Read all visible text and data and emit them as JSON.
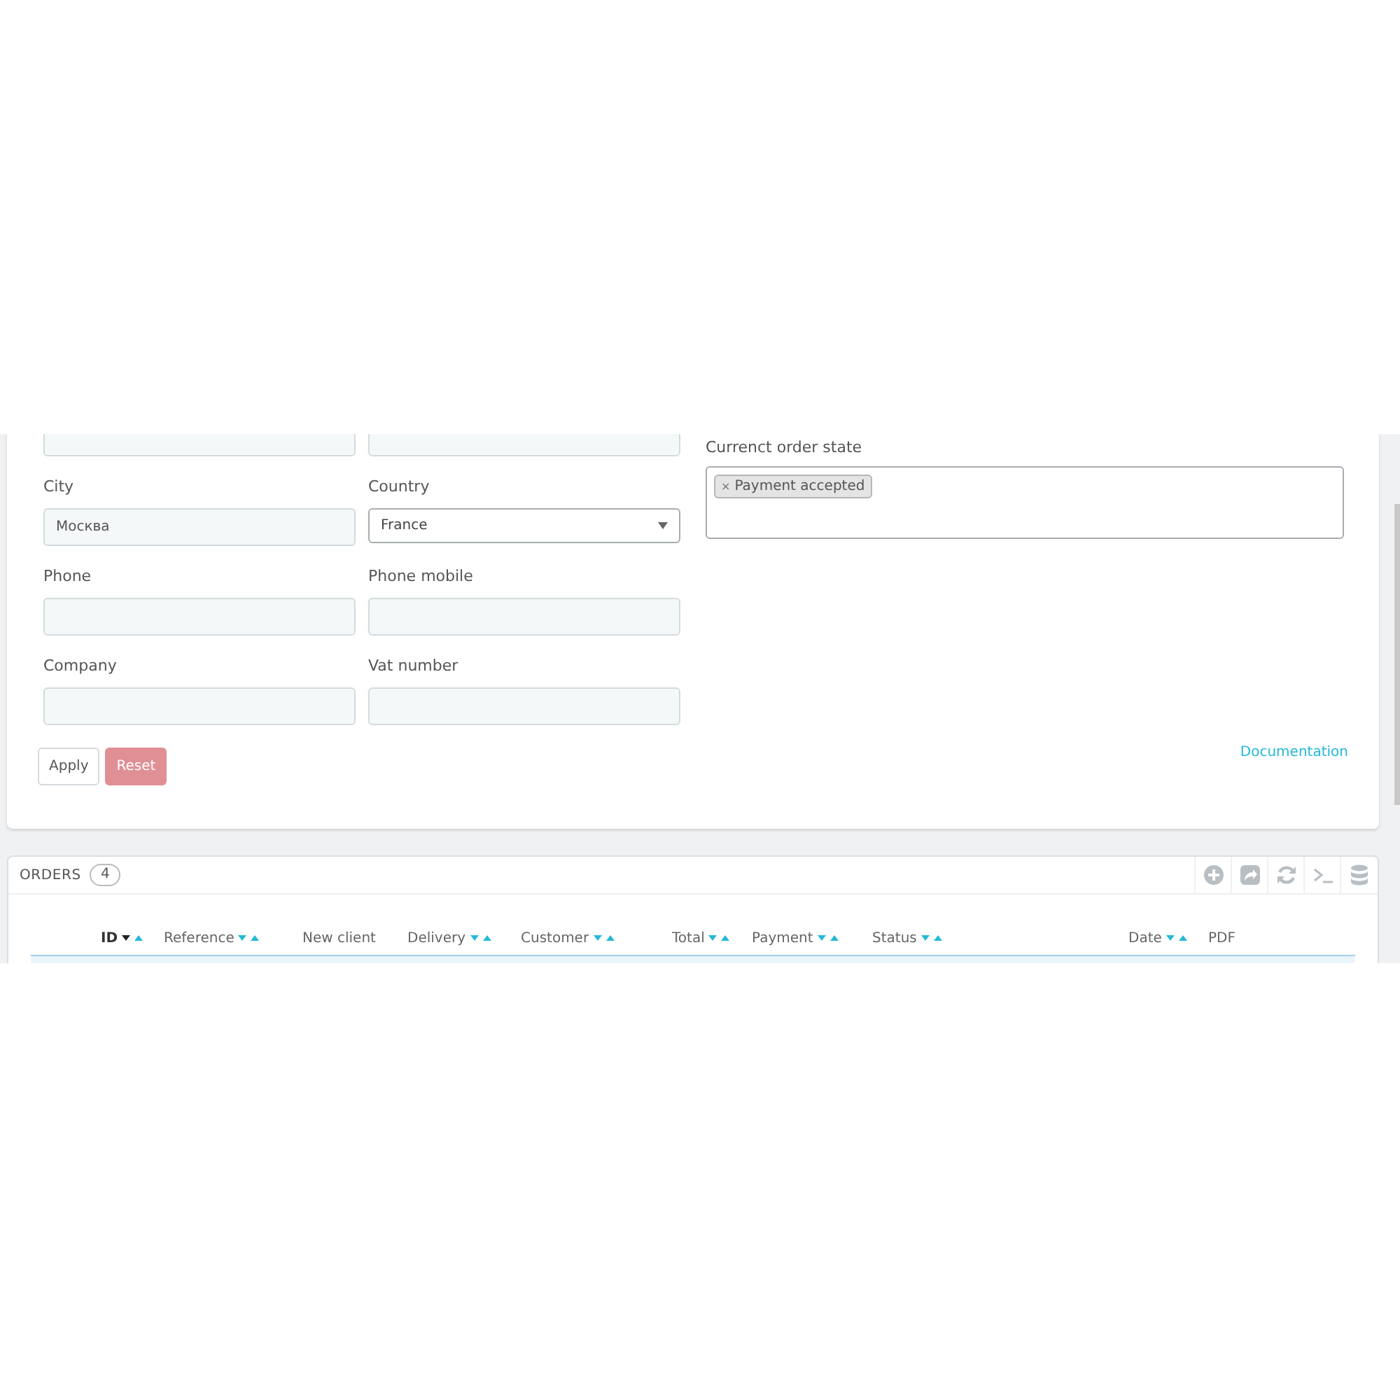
{
  "filter_form": {
    "fields": [
      {
        "kind": "input"
      },
      {
        "kind": "input"
      },
      {
        "label": "City",
        "kind": "input",
        "value": "Москва"
      },
      {
        "label": "Country",
        "kind": "select",
        "value": "France"
      },
      {
        "label": "Phone",
        "kind": "input"
      },
      {
        "label": "Phone mobile",
        "kind": "input"
      },
      {
        "label": "Company",
        "kind": "input"
      },
      {
        "label": "Vat number",
        "kind": "input"
      }
    ],
    "order_state": {
      "label": "Currenct order state",
      "tags": [
        {
          "remove": "×",
          "label": "Payment accepted"
        }
      ]
    },
    "buttons": [
      {
        "label": "Apply",
        "kind": "default"
      },
      {
        "label": "Reset",
        "kind": "danger"
      }
    ],
    "documentation_link": "Documentation"
  },
  "orders": {
    "title": "ORDERS",
    "count": "4",
    "columns": [
      {
        "label": "ID",
        "sortable": true,
        "sorted_desc": true
      },
      {
        "label": "Reference",
        "sortable": true,
        "sorted_desc": false
      },
      {
        "label": "New client",
        "sortable": false
      },
      {
        "label": "Delivery",
        "sortable": true,
        "sorted_desc": false
      },
      {
        "label": "Customer",
        "sortable": true,
        "sorted_desc": false
      },
      {
        "label": "Total",
        "sortable": true,
        "sorted_desc": false
      },
      {
        "label": "Payment",
        "sortable": true,
        "sorted_desc": false
      },
      {
        "label": "Status",
        "sortable": true,
        "sorted_desc": false
      },
      {
        "label": "Date",
        "sortable": true,
        "sorted_desc": false
      },
      {
        "label": "PDF",
        "sortable": false
      }
    ]
  }
}
